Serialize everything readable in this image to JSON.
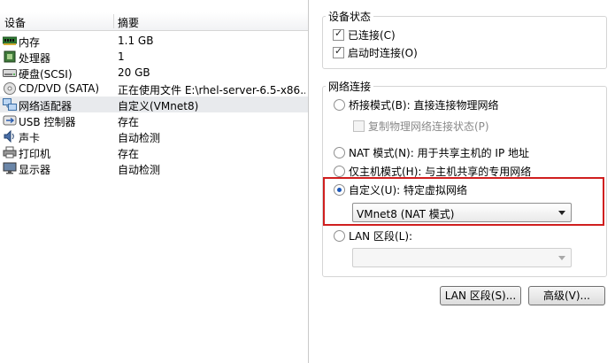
{
  "device_list": {
    "col_device": "设备",
    "col_summary": "摘要",
    "items": [
      {
        "name": "内存",
        "summary": "1.1 GB",
        "icon": "memory-icon"
      },
      {
        "name": "处理器",
        "summary": "1",
        "icon": "processor-icon"
      },
      {
        "name": "硬盘(SCSI)",
        "summary": "20 GB",
        "icon": "harddisk-icon"
      },
      {
        "name": "CD/DVD (SATA)",
        "summary": "正在使用文件 E:\\rhel-server-6.5-x86...",
        "icon": "cd-dvd-icon"
      },
      {
        "name": "网络适配器",
        "summary": "自定义(VMnet8)",
        "icon": "network-adapter-icon",
        "selected": true
      },
      {
        "name": "USB 控制器",
        "summary": "存在",
        "icon": "usb-icon"
      },
      {
        "name": "声卡",
        "summary": "自动检测",
        "icon": "sound-card-icon"
      },
      {
        "name": "打印机",
        "summary": "存在",
        "icon": "printer-icon"
      },
      {
        "name": "显示器",
        "summary": "自动检测",
        "icon": "display-icon"
      }
    ]
  },
  "device_status": {
    "title": "设备状态",
    "connected": {
      "label": "已连接(C)",
      "checked": true
    },
    "connect_at_power_on": {
      "label": "启动时连接(O)",
      "checked": true
    }
  },
  "network_connection": {
    "title": "网络连接",
    "bridged": {
      "label": "桥接模式(B): 直接连接物理网络",
      "selected": false
    },
    "replicate_state": {
      "label": "复制物理网络连接状态(P)",
      "checked": false,
      "disabled": true
    },
    "nat": {
      "label": "NAT 模式(N): 用于共享主机的 IP 地址",
      "selected": false
    },
    "host_only": {
      "label": "仅主机模式(H): 与主机共享的专用网络",
      "selected": false
    },
    "custom": {
      "label": "自定义(U): 特定虚拟网络",
      "selected": true
    },
    "custom_network_value": "VMnet8 (NAT 模式)",
    "lan_segment": {
      "label": "LAN 区段(L):",
      "selected": false
    },
    "lan_segment_value": ""
  },
  "buttons": {
    "lan_segments": "LAN 区段(S)...",
    "advanced": "高级(V)..."
  },
  "colors": {
    "highlight": "#d01f1f",
    "selected_row": "#e8eaed",
    "radio_dot": "#1a56b8"
  }
}
